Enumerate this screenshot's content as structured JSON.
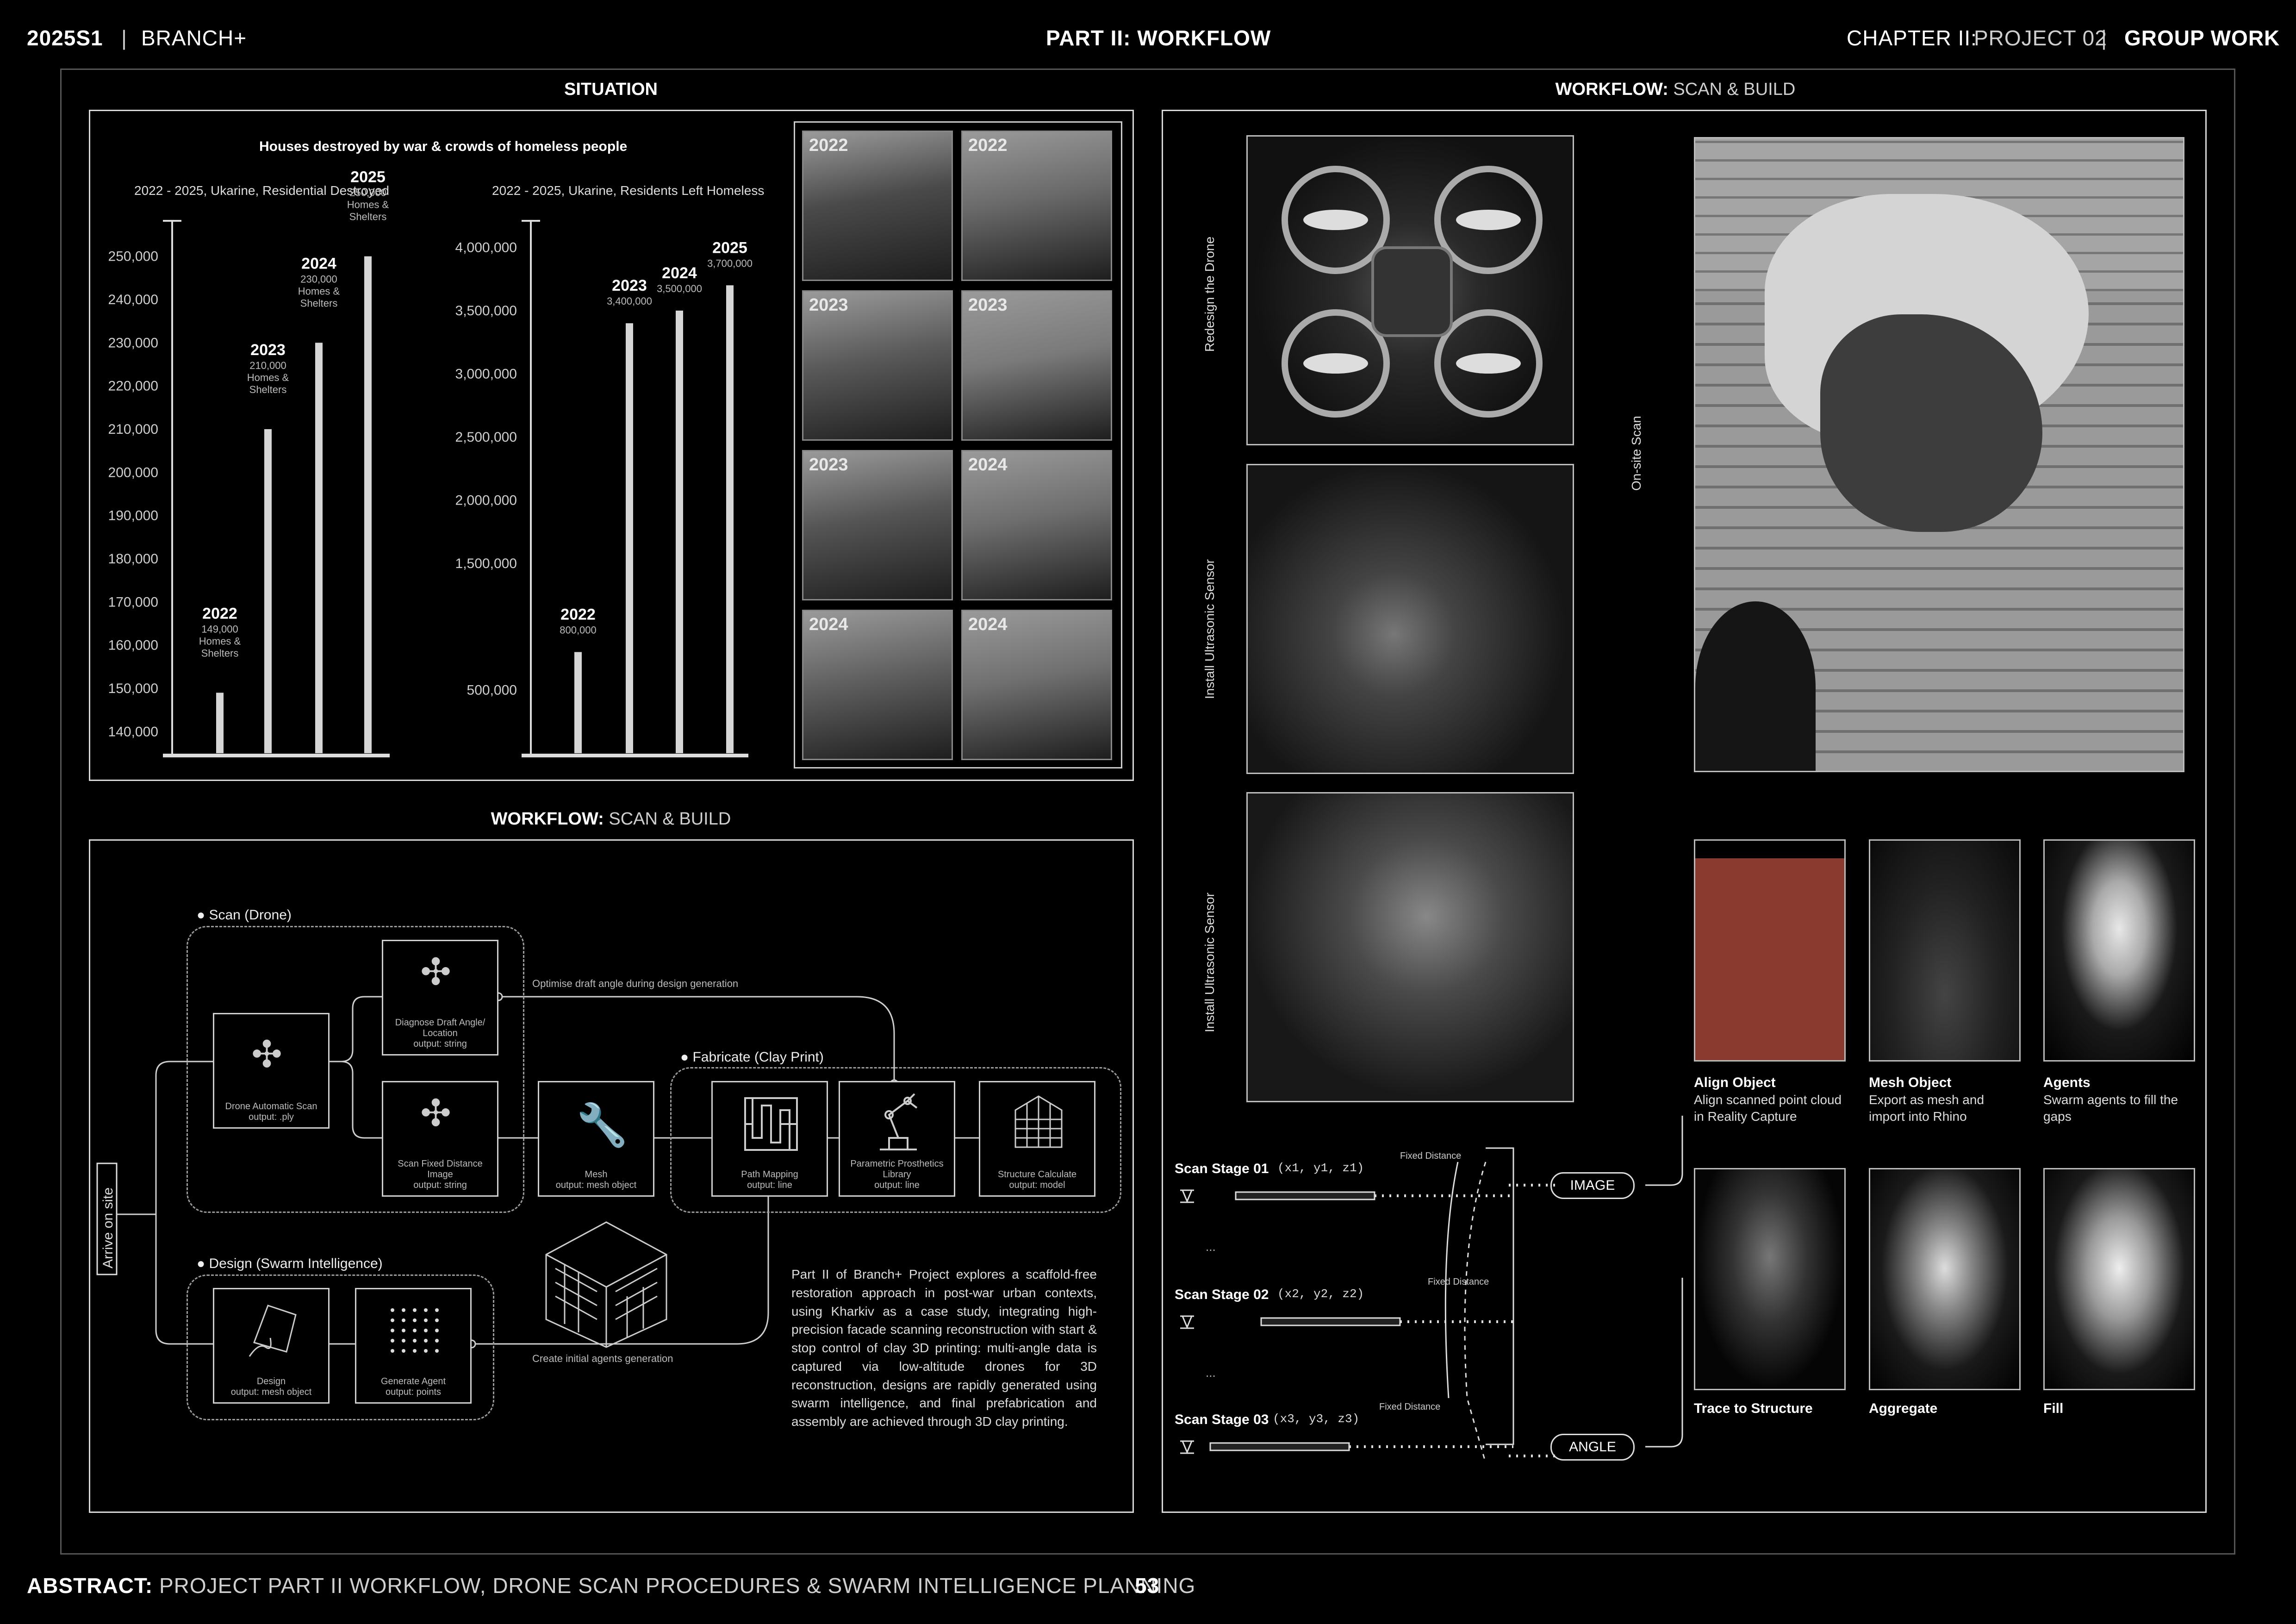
{
  "header": {
    "term": "2025S1",
    "project": "BRANCH+",
    "part": "PART II: WORKFLOW",
    "chapter_label": "CHAPTER II:",
    "chapter_value": "PROJECT 02",
    "group": "GROUP WORK"
  },
  "footer": {
    "abstract_label": "ABSTRACT:",
    "abstract_text": "PROJECT PART II WORKFLOW, DRONE SCAN PROCEDURES & SWARM INTELLIGENCE PLANNING",
    "page_number": "53"
  },
  "situation": {
    "title": "SITUATION",
    "subtitle": "Houses destroyed by war & crowds of homeless people",
    "photo_years": [
      "2022",
      "2022",
      "2023",
      "2023",
      "2023",
      "2024",
      "2024",
      "2024"
    ]
  },
  "chart_data": [
    {
      "type": "bar",
      "title": "2022 - 2025, Ukarine, Residential Destroyed",
      "categories": [
        "2022",
        "2023",
        "2024",
        "2025"
      ],
      "values": [
        149000,
        210000,
        230000,
        250000
      ],
      "labels": [
        "149,000\nHomes &\nShelters",
        "210,000\nHomes &\nShelters",
        "230,000\nHomes &\nShelters",
        "250,000\nHomes &\nShelters"
      ],
      "yticks": [
        "250,000",
        "240,000",
        "230,000",
        "220,000",
        "210,000",
        "200,000",
        "190,000",
        "180,000",
        "170,000",
        "160,000",
        "150,000",
        "140,000"
      ],
      "ylim": [
        135000,
        255000
      ]
    },
    {
      "type": "bar",
      "title": "2022 - 2025, Ukarine, Residents Left Homeless",
      "categories": [
        "2022",
        "2023",
        "2024",
        "2025"
      ],
      "values": [
        800000,
        3400000,
        3500000,
        3700000
      ],
      "labels": [
        "800,000",
        "3,400,000",
        "3,500,000",
        "3,700,000"
      ],
      "yticks": [
        "4,000,000",
        "3,500,000",
        "3,000,000",
        "2,500,000",
        "2,000,000",
        "1,500,000",
        "500,000"
      ],
      "ylim": [
        0,
        4100000
      ]
    }
  ],
  "workflow_left": {
    "title_bold": "WORKFLOW:",
    "title_rest": "SCAN & BUILD",
    "arrive": "Arrive on site",
    "scan_group": "Scan (Drone)",
    "fabricate_group": "Fabricate (Clay Print)",
    "design_group": "Design (Swarm Intelligence)",
    "optimise_note": "Optimise draft angle during design generation",
    "create_note": "Create initial agents generation",
    "nodes": {
      "drone_scan": "Drone Automatic Scan\noutput: .ply",
      "diagnose": "Diagnose Draft Angle/\nLocation\noutput: string",
      "scan_fixed": "Scan Fixed Distance\nImage\noutput: string",
      "mesh": "Mesh\noutput: mesh object",
      "path": "Path Mapping\noutput: line",
      "param": "Parametric Prosthetics\nLibrary\noutput: line",
      "structure": "Structure Calculate\noutput: model",
      "design": "Design\noutput: mesh object",
      "agent": "Generate Agent\noutput: points"
    },
    "paragraph": "Part II of Branch+ Project explores a scaffold-free restoration approach in post-war urban contexts, using Kharkiv as a case study, integrating high-precision facade scanning reconstruction with start & stop control of clay 3D printing: multi-angle data is captured via low-altitude drones for 3D reconstruction, designs are rapidly generated using swarm intelligence, and final prefabrication and assembly are achieved through 3D clay printing."
  },
  "workflow_right": {
    "title_bold": "WORKFLOW:",
    "title_rest": "SCAN & BUILD",
    "side_labels": [
      "Redesign the Drone",
      "Install Ultrasonic Sensor",
      "Install Ultrasonic Sensor",
      "On-site Scan"
    ],
    "stages": [
      {
        "name": "Scan Stage 01",
        "coord": "(x1, y1, z1)"
      },
      {
        "name": "Scan Stage 02",
        "coord": "(x2, y2, z2)"
      },
      {
        "name": "Scan Stage 03",
        "coord": "(x3, y3, z3)"
      }
    ],
    "fixed_distance": "Fixed Distance",
    "ellipsis": "...",
    "image_pill": "IMAGE",
    "angle_pill": "ANGLE",
    "cards": [
      {
        "title": "Align Object",
        "desc": "Align scanned point cloud in Reality Capture"
      },
      {
        "title": "Mesh Object",
        "desc": "Export as mesh and import into Rhino"
      },
      {
        "title": "Agents",
        "desc": "Swarm agents to fill the gaps"
      },
      {
        "title": "Trace to Structure",
        "desc": ""
      },
      {
        "title": "Aggregate",
        "desc": ""
      },
      {
        "title": "Fill",
        "desc": ""
      }
    ]
  },
  "colors": {
    "background": "#000000",
    "line": "#d8d8d8",
    "brick_red": "#8a3a2e"
  }
}
